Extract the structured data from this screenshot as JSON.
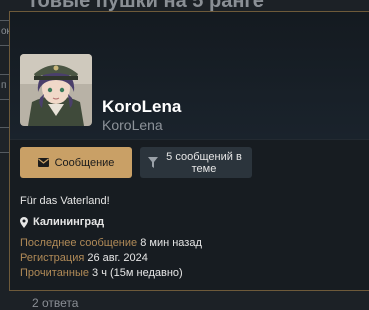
{
  "background": {
    "thread_title": "товые пушки на 5 ранге",
    "edge_tabs": [
      "ок",
      "п"
    ],
    "footer_text": "2 ответа"
  },
  "card": {
    "username": "KoroLena",
    "user_title": "KoroLena",
    "message_button": "Сообщение",
    "filter_button": "5 сообщений в теме",
    "status": "Für das Vaterland!",
    "location": "Калининград",
    "last_message_label": "Последнее сообщение",
    "last_message_value": "8 мин назад",
    "registered_label": "Регистрация",
    "registered_value": "26 авг. 2024",
    "read_label": "Прочитанные",
    "read_value": "3 ч (15м недавно)"
  },
  "icons": [
    "envelope-icon",
    "filter-icon",
    "map-pin-icon"
  ],
  "colors": {
    "accent": "#c9a066",
    "label": "#b08a57",
    "card_bg": "#171c21",
    "border": "#6e5a3a"
  }
}
